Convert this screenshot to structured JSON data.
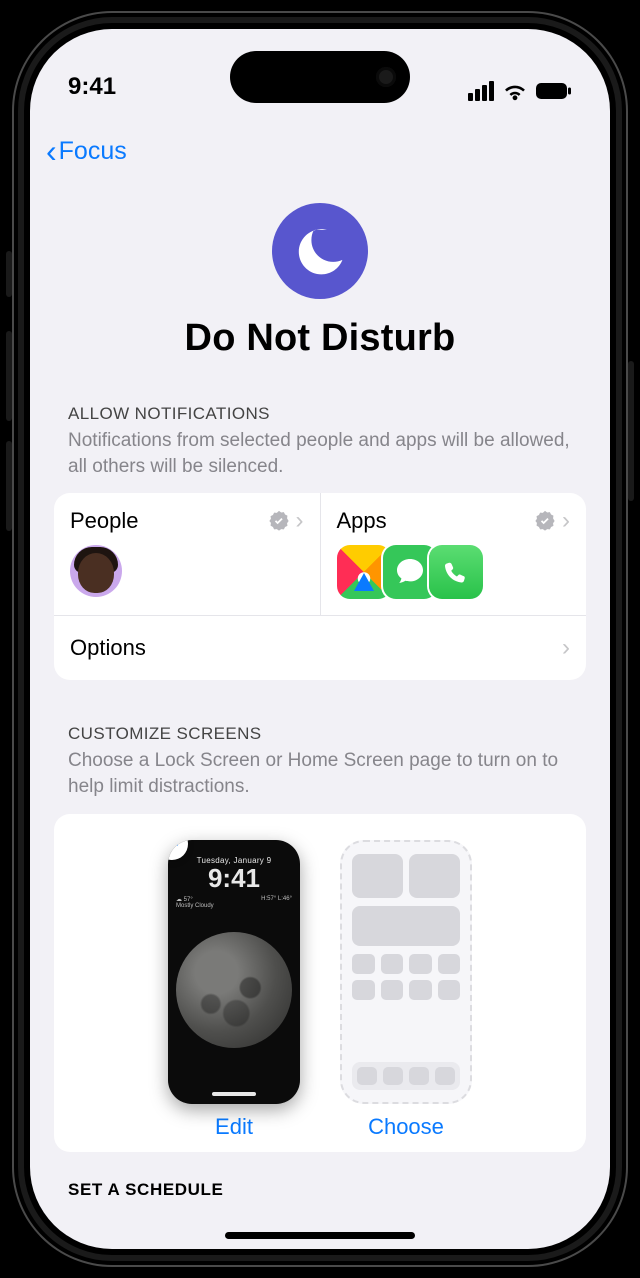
{
  "status": {
    "time": "9:41"
  },
  "nav": {
    "back_label": "Focus"
  },
  "hero": {
    "title": "Do Not Disturb",
    "icon": "moon-icon"
  },
  "allow": {
    "header": "ALLOW NOTIFICATIONS",
    "description": "Notifications from selected people and apps will be allowed, all others will be silenced.",
    "people_label": "People",
    "apps_label": "Apps",
    "apps": [
      "Maps",
      "Messages",
      "Phone"
    ],
    "options_label": "Options"
  },
  "customize": {
    "header": "CUSTOMIZE SCREENS",
    "description": "Choose a Lock Screen or Home Screen page to turn on to help limit distractions.",
    "lock": {
      "date": "Tuesday, January 9",
      "time": "9:41",
      "weather_desc": "Mostly Cloudy",
      "temp_hi_lo": "H:57° L:46°"
    },
    "edit_label": "Edit",
    "choose_label": "Choose"
  },
  "schedule": {
    "header": "SET A SCHEDULE"
  },
  "colors": {
    "accent": "#0a7aff",
    "focus_purple": "#5856ce"
  }
}
